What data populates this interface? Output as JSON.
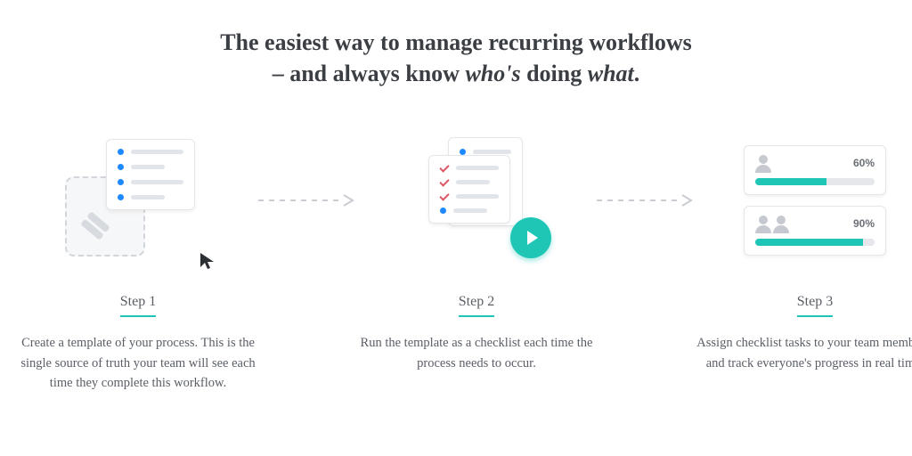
{
  "headline": {
    "line1": "The easiest way to manage recurring workflows",
    "line2_prefix": "– and always know ",
    "line2_em1": "who's",
    "line2_mid": " doing ",
    "line2_em2": "what",
    "line2_suffix": "."
  },
  "steps": [
    {
      "label": "Step 1",
      "description": "Create a template of your process. This is the single source of truth your team will see each time they complete this workflow."
    },
    {
      "label": "Step 2",
      "description": "Run the template as a checklist each time the process needs to occur."
    },
    {
      "label": "Step 3",
      "description": "Assign checklist tasks to your team members, and track everyone's progress in real time."
    }
  ],
  "progress": [
    {
      "percent_label": "60%",
      "percent": 60,
      "avatars": 1
    },
    {
      "percent_label": "90%",
      "percent": 90,
      "avatars": 2
    }
  ],
  "colors": {
    "accent": "#1fc6b6",
    "text": "#3b3f44",
    "muted": "#5a5f66"
  }
}
